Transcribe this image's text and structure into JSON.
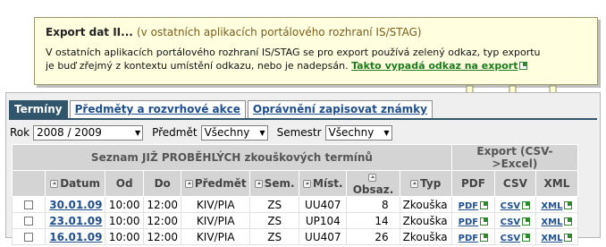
{
  "tooltip": {
    "title": "Export dat II...",
    "subtitle": "(v ostatních aplikacích portálového rozhraní IS/STAG)",
    "body_line1": "V ostatních aplikacích portálového rozhraní IS/STAG se pro export používá zelený odkaz, typ exportu",
    "body_line2": "je buď zřejmý z kontextu umístění odkazu, nebo je nadepsán.",
    "link": "Takto vypadá odkaz na export",
    "link_icon": "external-link-icon"
  },
  "tabs": [
    {
      "label": "Termíny",
      "active": true
    },
    {
      "label": "Předměty a rozvrhové akce",
      "active": false
    },
    {
      "label": "Oprávnění zapisovat známky",
      "active": false
    }
  ],
  "filters": {
    "rok_label": "Rok",
    "rok_value": "2008 / 2009",
    "predmet_label": "Předmět",
    "predmet_value": "Všechny",
    "semestr_label": "Semestr",
    "semestr_value": "Všechny"
  },
  "table": {
    "group_title": "Seznam JIŽ PROBĚHLÝCH zkouškových termínů",
    "export_title": "Export (CSV->Excel)",
    "columns": [
      "Datum",
      "Od",
      "Do",
      "Předmět",
      "Sem.",
      "Míst.",
      "Obsaz.",
      "Typ"
    ],
    "export_columns": [
      "PDF",
      "CSV",
      "XML"
    ],
    "rows": [
      {
        "datum": "30.01.09",
        "od": "10:00",
        "do": "12:00",
        "predmet": "KIV/PIA",
        "sem": "ZS",
        "mist": "UU407",
        "obsaz": "8",
        "typ": "Zkouška"
      },
      {
        "datum": "23.01.09",
        "od": "10:00",
        "do": "12:00",
        "predmet": "KIV/PIA",
        "sem": "ZS",
        "mist": "UP104",
        "obsaz": "14",
        "typ": "Zkouška"
      },
      {
        "datum": "16.01.09",
        "od": "10:00",
        "do": "12:00",
        "predmet": "KIV/PIA",
        "sem": "ZS",
        "mist": "UU407",
        "obsaz": "26",
        "typ": "Zkouška"
      }
    ],
    "export_links": {
      "pdf": "PDF",
      "csv": "CSV",
      "xml": "XML"
    }
  },
  "colors": {
    "accent": "#31566b",
    "link": "#1f4f8f",
    "export_link": "#1c7a1c",
    "tooltip_bg": "#ffffe0"
  }
}
